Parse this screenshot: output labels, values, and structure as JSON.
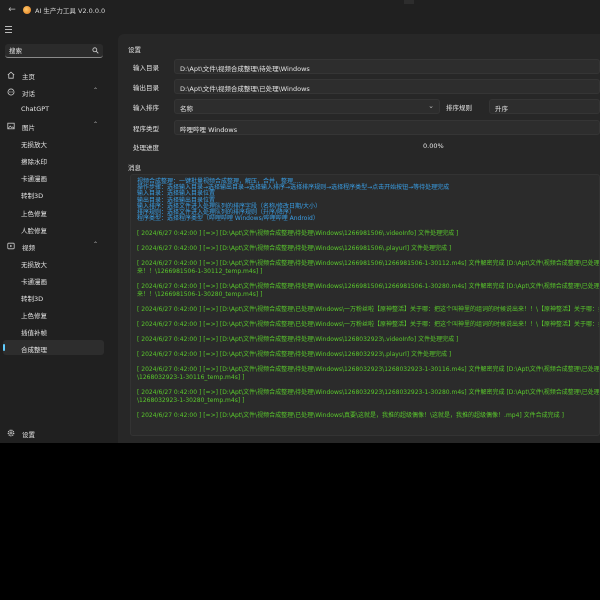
{
  "titlebar": {
    "title": "AI 生产力工具 V2.0.0.0"
  },
  "sidebar": {
    "search_placeholder": "搜索",
    "home": "主页",
    "chat": "对话",
    "chatgpt": "ChatGPT",
    "images": "图片",
    "image_items": [
      "无损放大",
      "擦除水印",
      "卡通漫画",
      "转制3D",
      "上色修复",
      "人脸修复"
    ],
    "video": "视频",
    "video_items": [
      "无损放大",
      "卡通漫画",
      "转制3D",
      "上色修复",
      "插值补帧",
      "合成整理"
    ],
    "settings": "设置"
  },
  "main": {
    "settings_title": "设置",
    "input_dir_label": "输入目录",
    "input_dir_value": "D:\\Apt\\文件\\视频合成整理\\待处理\\Windows",
    "output_dir_label": "输出目录",
    "output_dir_value": "D:\\Apt\\文件\\视频合成整理\\已处理\\Windows",
    "input_sort_label": "输入排序",
    "input_sort_value": "名称",
    "sort_rule_label": "排序规则",
    "sort_rule_value": "升序",
    "program_type_label": "程序类型",
    "program_type_value": "哔哩哔哩 Windows",
    "progress_label": "处理进度",
    "progress_value": "0.00%",
    "messages_title": "消息"
  },
  "log": {
    "intro": [
      "视频合成整理：一键批量视频合成整理，解压，合并，整理.....",
      "操作步骤：选择输入目录→选择输出目录→选择输入排序→选择排序规则→选择程序类型→点击开始按钮→等待处理完成",
      "输入目录：选择输入目录位置",
      "输出目录：选择输出目录位置",
      "输入排序：选择文件进入处理队列的排序字段（名称/修改日期/大小）",
      "排序规则：选择文件进入处理队列的排序规则（升序/降序）",
      "程序类型：选择程序类型（哔哩哔哩 Windows/哔哩哔哩 Android）"
    ],
    "entries": [
      [
        "[ 2024/6/27 0:42:00 ] [=>] [D:\\Apt\\文件\\视频合成整理\\待处理\\Windows\\1266981506\\.videoInfo] 文件处理完成 ]"
      ],
      [
        "[ 2024/6/27 0:42:00 ] [=>] [D:\\Apt\\文件\\视频合成整理\\待处理\\Windows\\1266981506\\.playurl] 文件处理完成 ]"
      ],
      [
        "[ 2024/6/27 0:42:00 ] [=>] [D:\\Apt\\文件\\视频合成整理\\待处理\\Windows\\1266981506\\1266981506-1-30112.m4s] 文件解密完成 [D:\\Apt\\文件\\视频合成整理\\已处理\\Windows\\",
        "来！！\\1266981506-1-30112_temp.m4s] ]"
      ],
      [
        "[ 2024/6/27 0:42:00 ] [=>] [D:\\Apt\\文件\\视频合成整理\\待处理\\Windows\\1266981506\\1266981506-1-30280.m4s] 文件解密完成 [D:\\Apt\\文件\\视频合成整理\\已处理\\Windows\\",
        "来！！\\1266981506-1-30280_temp.m4s] ]"
      ],
      [
        "[ 2024/6/27 0:42:00 ] [=>] [D:\\Apt\\文件\\视频合成整理\\已处理\\Windows\\一万粉丝啦【原神整活】关于哪：把这个叫神里的组词的时候说出来！！\\【原神整活】关于哪：把这个叫神"
      ],
      [
        "[ 2024/6/27 0:42:00 ] [=>] [D:\\Apt\\文件\\视频合成整理\\已处理\\Windows\\一万粉丝啦【原神整活】关于哪：把这个叫神里的组词的时候说出来！！\\【原神整活】关于哪：把这个叫神"
      ],
      [
        "[ 2024/6/27 0:42:00 ] [=>] [D:\\Apt\\文件\\视频合成整理\\待处理\\Windows\\1268032923\\.videoInfo] 文件处理完成 ]"
      ],
      [
        "[ 2024/6/27 0:42:00 ] [=>] [D:\\Apt\\文件\\视频合成整理\\待处理\\Windows\\1268032923\\.playurl] 文件处理完成 ]"
      ],
      [
        "[ 2024/6/27 0:42:00 ] [=>] [D:\\Apt\\文件\\视频合成整理\\待处理\\Windows\\1268032923\\1268032923-1-30116.m4s] 文件解密完成 [D:\\Apt\\文件\\视频合成整理\\已处理\\Windows\\",
        "\\1268032923-1-30116_temp.m4s] ]"
      ],
      [
        "[ 2024/6/27 0:42:00 ] [=>] [D:\\Apt\\文件\\视频合成整理\\待处理\\Windows\\1268032923\\1268032923-1-30280.m4s] 文件解密完成 [D:\\Apt\\文件\\视频合成整理\\已处理\\Windows\\",
        "\\1268032923-1-30280_temp.m4s] ]"
      ],
      [
        "[ 2024/6/27 0:42:00 ] [=>] [D:\\Apt\\文件\\视频合成整理\\已处理\\Windows\\真要\\这就是，我推的超级偶像！\\这就是，我推的超级偶像！.mp4] 文件合成完成 ]"
      ]
    ]
  },
  "colors": {
    "accent": "#60cdff",
    "log_info": "#3aa0e8",
    "log_success": "#5ac92c",
    "window_bg": "#202020",
    "content_bg": "#272727"
  },
  "icons": [
    "back-arrow-icon",
    "app-logo",
    "hamburger-icon",
    "search-icon",
    "home-icon",
    "chat-icon",
    "image-icon",
    "video-icon",
    "settings-gear-icon",
    "chevron-up-icon",
    "chevron-down-icon"
  ]
}
